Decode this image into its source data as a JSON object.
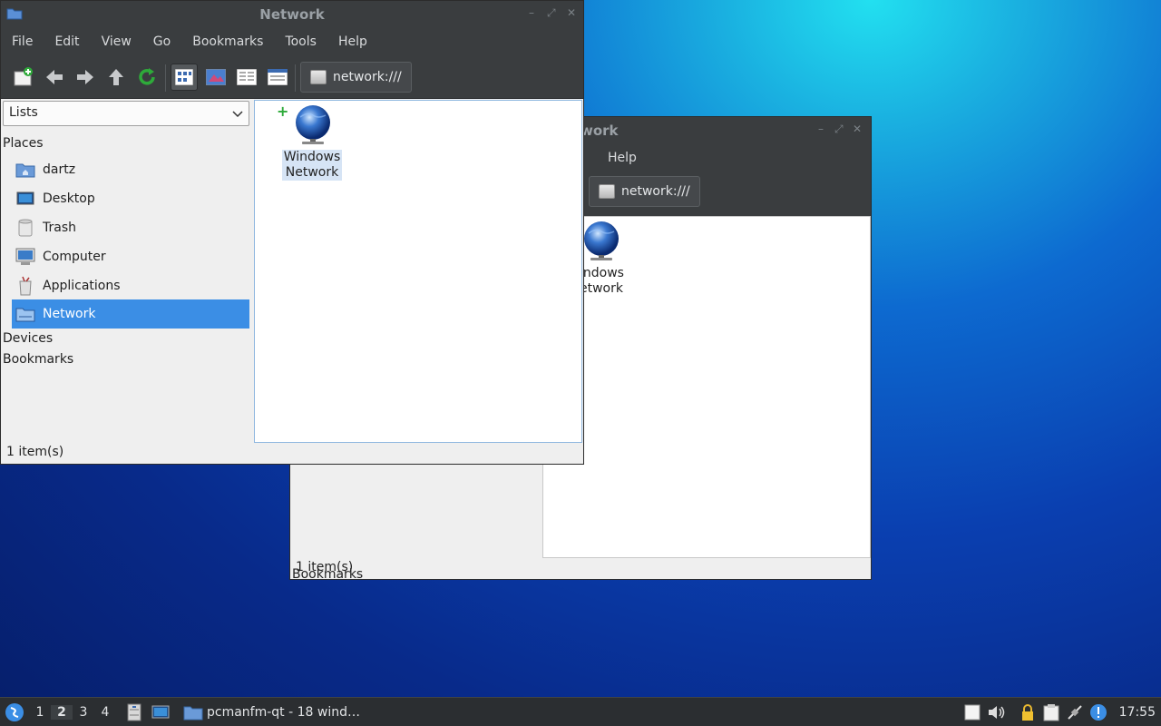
{
  "back_window": {
    "title_fragment": "work",
    "menu_help": "Help",
    "location": "network:///",
    "file_label_line1": "indows",
    "file_label_line2": "etwork",
    "section_bookmarks": "Bookmarks",
    "status": "1 item(s)"
  },
  "front_window": {
    "title": "Network",
    "menu": [
      "File",
      "Edit",
      "View",
      "Go",
      "Bookmarks",
      "Tools",
      "Help"
    ],
    "location": "network:///",
    "side_pane_mode": "Lists",
    "sections": {
      "places": "Places",
      "devices": "Devices",
      "bookmarks": "Bookmarks"
    },
    "places": [
      {
        "label": "dartz",
        "icon": "home-folder-icon"
      },
      {
        "label": "Desktop",
        "icon": "desktop-icon"
      },
      {
        "label": "Trash",
        "icon": "trash-icon"
      },
      {
        "label": "Computer",
        "icon": "computer-icon"
      },
      {
        "label": "Applications",
        "icon": "applications-icon"
      },
      {
        "label": "Network",
        "icon": "network-icon",
        "selected": true
      }
    ],
    "file": {
      "line1": "Windows",
      "line2": "Network"
    },
    "status": "1 item(s)"
  },
  "panel": {
    "workspaces": [
      "1",
      "2",
      "3",
      "4"
    ],
    "current_workspace": "2",
    "task_label": "pcmanfm-qt - 18 wind…",
    "clock": "17:55"
  },
  "colors": {
    "selection": "#3b8ee5",
    "toolbar": "#3a3d3f",
    "panel": "#2b2e31"
  }
}
